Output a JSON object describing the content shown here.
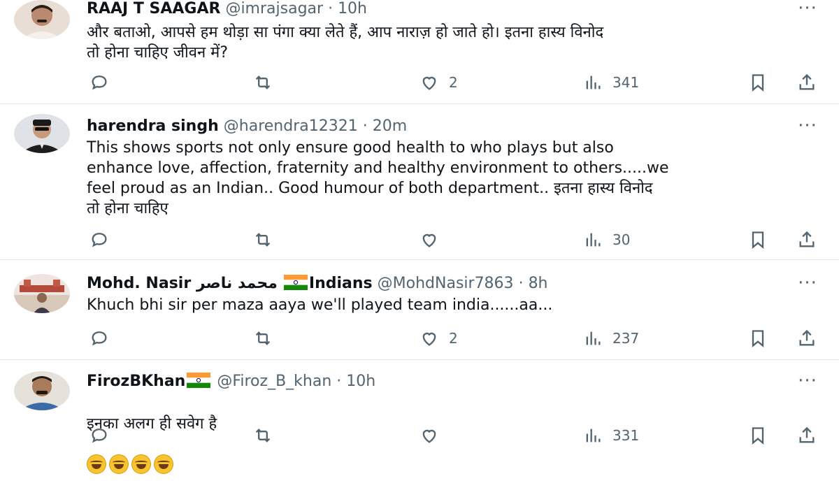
{
  "tweets": [
    {
      "name": "RAAJ T SAAGAR",
      "handle": "@imrajsagar",
      "sep": "·",
      "time": "10h",
      "text": "और बताओ, आपसे हम थोड़ा सा पंगा क्या लेते हैं, आप नाराज़ हो जाते हो। इतना हास्य विनोद\nतो होना चाहिए जीवन में?",
      "reply_count": "",
      "retweet_count": "",
      "like_count": "2",
      "view_count": "341"
    },
    {
      "name": "harendra singh",
      "handle": "@harendra12321",
      "sep": "·",
      "time": "20m",
      "text": "This shows sports not only ensure good health to who plays but also\nenhance love, affection, fraternity and healthy environment to others.....we\nfeel proud as an Indian.. Good humour of both department.. इतना हास्य विनोद\nतो होना चाहिए",
      "reply_count": "",
      "retweet_count": "",
      "like_count": "",
      "view_count": "30"
    },
    {
      "name": "Mohd. Nasir محمد ناصر",
      "name_suffix": "Indians",
      "handle": "@MohdNasir7863",
      "sep": "·",
      "time": "8h",
      "text": "Khuch bhi sir per maza aaya we'll played team india......aa...",
      "reply_count": "",
      "retweet_count": "",
      "like_count": "2",
      "view_count": "237"
    },
    {
      "name": "FirozBKhan",
      "handle": "@Firoz_B_khan",
      "sep": "·",
      "time": "10h",
      "text": "इनका अलग ही सवेग है",
      "emoji_count_label": "🤣🤣🤣🤣",
      "reply_count": "",
      "retweet_count": "",
      "like_count": "",
      "view_count": "331"
    }
  ],
  "icons": {
    "reply": "reply-icon",
    "retweet": "retweet-icon",
    "like": "heart-icon",
    "views": "views-icon",
    "bookmark": "bookmark-icon",
    "share": "share-icon",
    "more": "more-icon"
  },
  "colors": {
    "text": "#0f1419",
    "secondary": "#536471",
    "divider": "#e7e9ea"
  }
}
